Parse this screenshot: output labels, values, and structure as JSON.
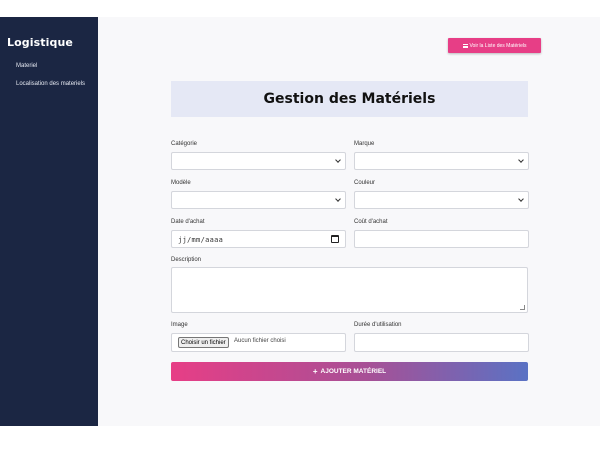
{
  "sidebar": {
    "brand": "Logistique",
    "items": [
      {
        "label": "Materiel"
      },
      {
        "label": "Localisation des materiels"
      }
    ]
  },
  "header": {
    "list_button_label": "Voir la Liste des Matériels",
    "list_button_icon": "list-icon",
    "title": "Gestion des Matériels"
  },
  "form": {
    "categorie": {
      "label": "Catégorie",
      "value": ""
    },
    "marque": {
      "label": "Marque",
      "value": ""
    },
    "modele": {
      "label": "Modèle",
      "value": ""
    },
    "couleur": {
      "label": "Couleur",
      "value": ""
    },
    "date_achat": {
      "label": "Date d'achat",
      "placeholder": "jj/mm/aaaa"
    },
    "cout_achat": {
      "label": "Coût d'achat",
      "value": ""
    },
    "description": {
      "label": "Description",
      "value": ""
    },
    "image": {
      "label": "Image",
      "button_label": "Choisir un fichier",
      "status": "Aucun fichier choisi"
    },
    "duree": {
      "label": "Durée d'utilisation",
      "value": ""
    },
    "submit_label": "AJOUTER MATÉRIEL",
    "submit_icon": "plus-icon"
  },
  "colors": {
    "sidebar_bg": "#1b2643",
    "accent_pink": "#e73e86",
    "accent_blue": "#5a72c4",
    "title_bg": "#e5e8f5"
  }
}
